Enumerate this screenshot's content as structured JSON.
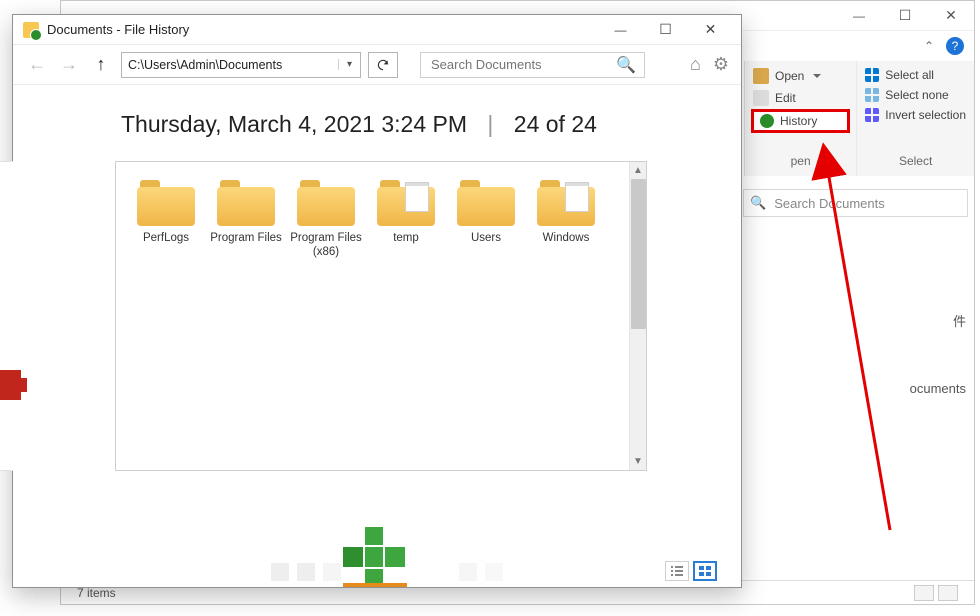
{
  "bgWindow": {
    "ribbon": {
      "col1": {
        "open": "Open",
        "edit": "Edit",
        "history": "History",
        "sectionLabel": "pen"
      },
      "col2": {
        "selectAll": "Select all",
        "selectNone": "Select none",
        "invert": "Invert selection",
        "sectionLabel": "Select"
      }
    },
    "search": {
      "placeholder": "Search Documents"
    },
    "nav": {
      "item1": "件",
      "item2": "ocuments"
    },
    "status": {
      "itemCount": "7 items"
    }
  },
  "fh": {
    "title": "Documents - File History",
    "addressPath": "C:\\Users\\Admin\\Documents",
    "search": {
      "placeholder": "Search Documents"
    },
    "snapshot": {
      "timestamp": "Thursday, March 4, 2021 3:24 PM",
      "position": "24 of 24"
    },
    "folders": [
      {
        "name": "PerfLogs",
        "hasfile": false
      },
      {
        "name": "Program Files",
        "hasfile": false
      },
      {
        "name": "Program Files (x86)",
        "hasfile": false
      },
      {
        "name": "temp",
        "hasfile": true
      },
      {
        "name": "Users",
        "hasfile": false
      },
      {
        "name": "Windows",
        "hasfile": true
      }
    ]
  }
}
